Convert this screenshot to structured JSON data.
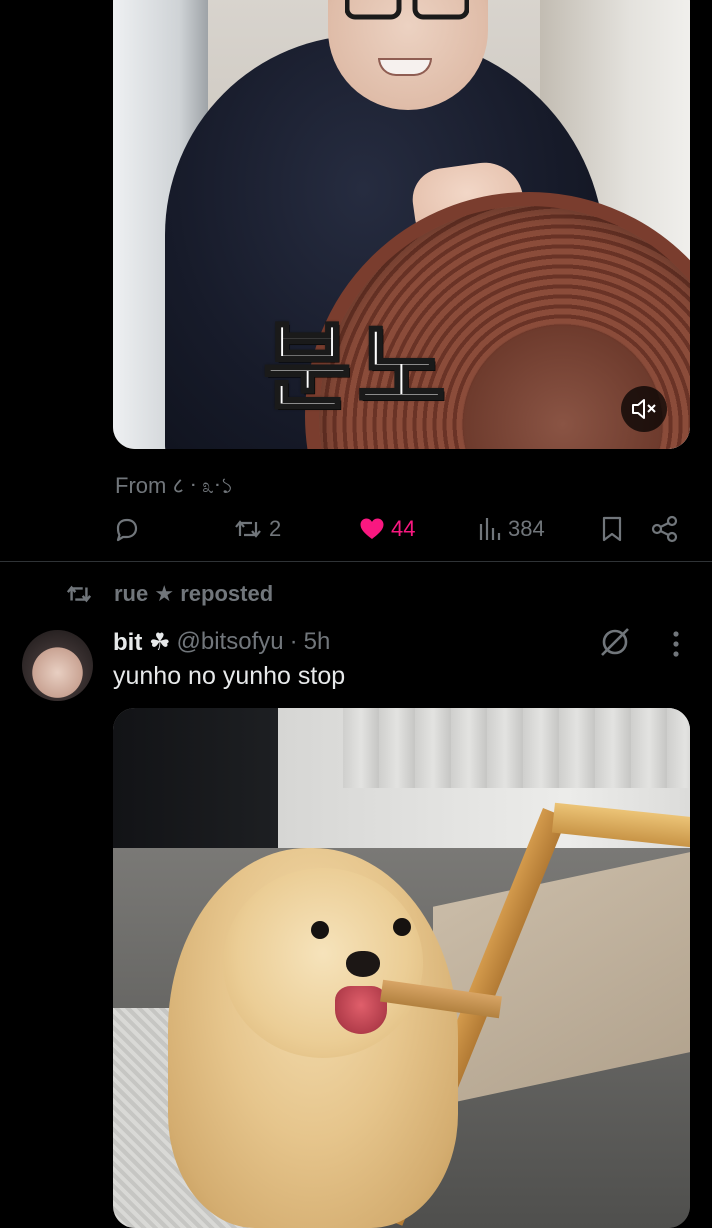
{
  "post_top": {
    "media_caption": "분노",
    "from_prefix": "From",
    "from_name": "८ ᐧ ೩ᐧ১",
    "actions": {
      "reply_count": "",
      "repost_count": "2",
      "like_count": "44",
      "views_count": "384"
    },
    "colors": {
      "like_active": "#f91880",
      "muted_text": "#71767b"
    }
  },
  "repost_banner": {
    "reposter": "rue",
    "star": "★",
    "action": "reposted"
  },
  "post_bottom": {
    "display_name": "bit",
    "name_emoji": "☘",
    "handle": "@bitsofyu",
    "separator": "·",
    "time": "5h",
    "text": "yunho no yunho stop"
  },
  "icons": {
    "mute": "speaker-muted-icon",
    "reply": "reply-icon",
    "repost": "repost-icon",
    "like": "heart-icon",
    "views": "views-chart-icon",
    "bookmark": "bookmark-icon",
    "share": "share-icon",
    "grok": "grok-icon",
    "more": "more-vertical-icon"
  }
}
